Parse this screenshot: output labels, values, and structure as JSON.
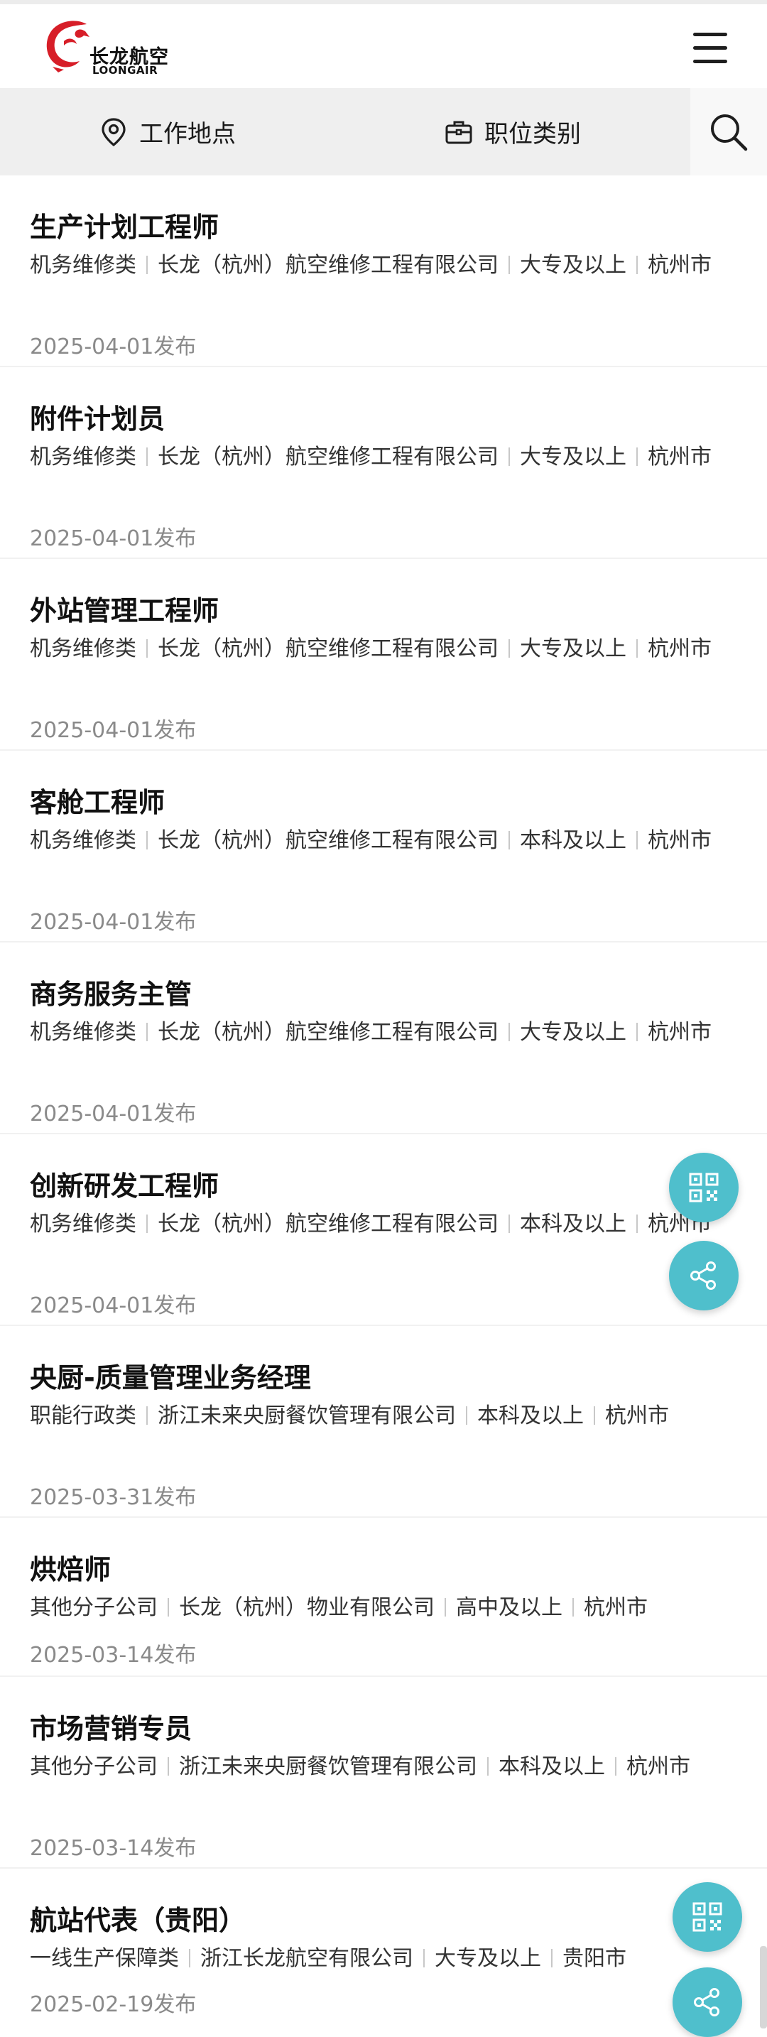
{
  "header": {
    "logo_cn": "长龙航空",
    "logo_en": "LOONGAIR"
  },
  "filters": {
    "location_label": "工作地点",
    "category_label": "职位类别"
  },
  "icons": {
    "menu": "menu-icon",
    "location": "location-pin-icon",
    "category": "briefcase-icon",
    "search": "search-icon",
    "qrcode": "qrcode-icon",
    "share": "share-icon"
  },
  "colors": {
    "fab": "#4fbfcc",
    "logo_red": "#d71e28",
    "filter_bg": "#efefef"
  },
  "jobs": [
    {
      "title": "生产计划工程师",
      "category": "机务维修类",
      "company": "长龙（杭州）航空维修工程有限公司",
      "education": "大专及以上",
      "city": "杭州市",
      "date": "2025-04-01发布"
    },
    {
      "title": "附件计划员",
      "category": "机务维修类",
      "company": "长龙（杭州）航空维修工程有限公司",
      "education": "大专及以上",
      "city": "杭州市",
      "date": "2025-04-01发布"
    },
    {
      "title": "外站管理工程师",
      "category": "机务维修类",
      "company": "长龙（杭州）航空维修工程有限公司",
      "education": "大专及以上",
      "city": "杭州市",
      "date": "2025-04-01发布"
    },
    {
      "title": "客舱工程师",
      "category": "机务维修类",
      "company": "长龙（杭州）航空维修工程有限公司",
      "education": "本科及以上",
      "city": "杭州市",
      "date": "2025-04-01发布"
    },
    {
      "title": "商务服务主管",
      "category": "机务维修类",
      "company": "长龙（杭州）航空维修工程有限公司",
      "education": "大专及以上",
      "city": "杭州市",
      "date": "2025-04-01发布"
    },
    {
      "title": "创新研发工程师",
      "category": "机务维修类",
      "company": "长龙（杭州）航空维修工程有限公司",
      "education": "本科及以上",
      "city": "杭州市",
      "date": "2025-04-01发布"
    },
    {
      "title": "央厨-质量管理业务经理",
      "category": "职能行政类",
      "company": "浙江未来央厨餐饮管理有限公司",
      "education": "本科及以上",
      "city": "杭州市",
      "date": "2025-03-31发布"
    },
    {
      "title": "烘焙师",
      "category": "其他分子公司",
      "company": "长龙（杭州）物业有限公司",
      "education": "高中及以上",
      "city": "杭州市",
      "date": "2025-03-14发布"
    },
    {
      "title": "市场营销专员",
      "category": "其他分子公司",
      "company": "浙江未来央厨餐饮管理有限公司",
      "education": "本科及以上",
      "city": "杭州市",
      "date": "2025-03-14发布"
    },
    {
      "title": "航站代表（贵阳）",
      "category": "一线生产保障类",
      "company": "浙江长龙航空有限公司",
      "education": "大专及以上",
      "city": "贵阳市",
      "date": "2025-02-19发布"
    }
  ]
}
